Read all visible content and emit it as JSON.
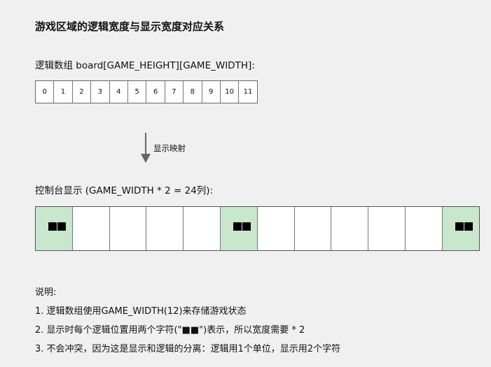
{
  "title": "游戏区域的逻辑宽度与显示宽度对应关系",
  "logic_label": "逻辑数组 board[GAME_HEIGHT][GAME_WIDTH]:",
  "logic_cells": [
    "0",
    "1",
    "2",
    "3",
    "4",
    "5",
    "6",
    "7",
    "8",
    "9",
    "10",
    "11"
  ],
  "arrow_label": "显示映射",
  "display_label": "控制台显示 (GAME_WIDTH * 2 = 24列):",
  "display_cells_filled": [
    true,
    false,
    false,
    false,
    false,
    true,
    false,
    false,
    false,
    false,
    false,
    true
  ],
  "colors": {
    "filled": "#c9e7cc",
    "block": "#000000"
  },
  "notes_title": "说明:",
  "notes": [
    "1. 逻辑数组使用GAME_WIDTH(12)来存储游戏状态",
    "2. 显示时每个逻辑位置用两个字符(\"■■\")表示，所以宽度需要 * 2",
    "3. 不会冲突，因为这是显示和逻辑的分离：逻辑用1个单位，显示用2个字符"
  ]
}
